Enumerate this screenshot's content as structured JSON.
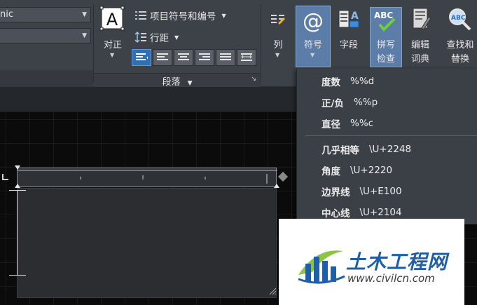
{
  "ribbon": {
    "font_dropdown_1": "nic",
    "font_dropdown_2": "",
    "justify_label": "对正",
    "bullets_label": "项目符号和编号",
    "line_spacing_label": "行距",
    "paragraph_panel_title": "段落",
    "columns_label": "列",
    "symbol_label": "符号",
    "field_label": "字段",
    "spellcheck_label_line1": "拼写",
    "spellcheck_label_line2": "检查",
    "dictionary_label_line1": "编辑",
    "dictionary_label_line2": "词典",
    "findreplace_label_line1": "查找和",
    "findreplace_label_line2": "替换",
    "spellcheck_icon_text": "ABC",
    "findreplace_icon_text": "ABC"
  },
  "symbol_menu": {
    "items": [
      {
        "label": "度数",
        "code": "%%d"
      },
      {
        "label": "正/负",
        "code": "%%p"
      },
      {
        "label": "直径",
        "code": "%%c"
      },
      {
        "label": "几乎相等",
        "code": "\\U+2248"
      },
      {
        "label": "角度",
        "code": "\\U+2220"
      },
      {
        "label": "边界线",
        "code": "\\U+E100"
      },
      {
        "label": "中心线",
        "code": "\\U+2104"
      }
    ]
  },
  "watermark": {
    "title": "土木工程网",
    "url": "www.civilcn.com"
  },
  "colors": {
    "ribbon_bg": "#3d4148",
    "highlight": "#5b7da8",
    "menu_bg": "#3b3f46",
    "watermark_blue": "#1f5fa8",
    "watermark_green": "#8cc63f"
  }
}
